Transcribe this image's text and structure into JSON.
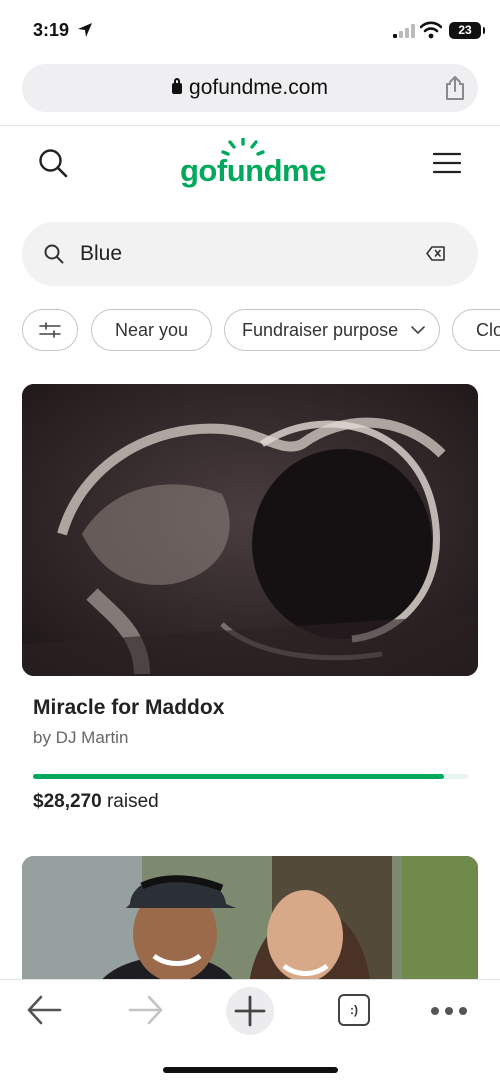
{
  "status_bar": {
    "time": "3:19",
    "battery": "23",
    "icons": [
      "location-arrow-icon",
      "signal-icon",
      "wifi-icon",
      "battery-icon"
    ]
  },
  "browser": {
    "url": "gofundme.com",
    "icons": [
      "lock-icon",
      "share-icon"
    ]
  },
  "header": {
    "logo_text": "gofundme",
    "icons": [
      "search-icon",
      "menu-icon"
    ],
    "brand_color": "#02a95c"
  },
  "search": {
    "value": "Blue",
    "icons": [
      "search-icon",
      "clear-input-icon"
    ]
  },
  "filters": {
    "near_label": "Near you",
    "purpose_label": "Fundraiser purpose",
    "close_label": "Clo",
    "icons": [
      "filter-sliders-icon",
      "chevron-down-icon"
    ]
  },
  "fundraisers": [
    {
      "title": "Miracle for Maddox",
      "author": "by DJ Martin",
      "amount": "$28,270",
      "raised_suffix": " raised",
      "progress": 0.945
    }
  ],
  "toolbar": {
    "tabs_label": ":)",
    "icons": [
      "back-arrow-icon",
      "forward-arrow-icon",
      "new-tab-plus-icon",
      "tabs-icon",
      "more-icon"
    ]
  }
}
